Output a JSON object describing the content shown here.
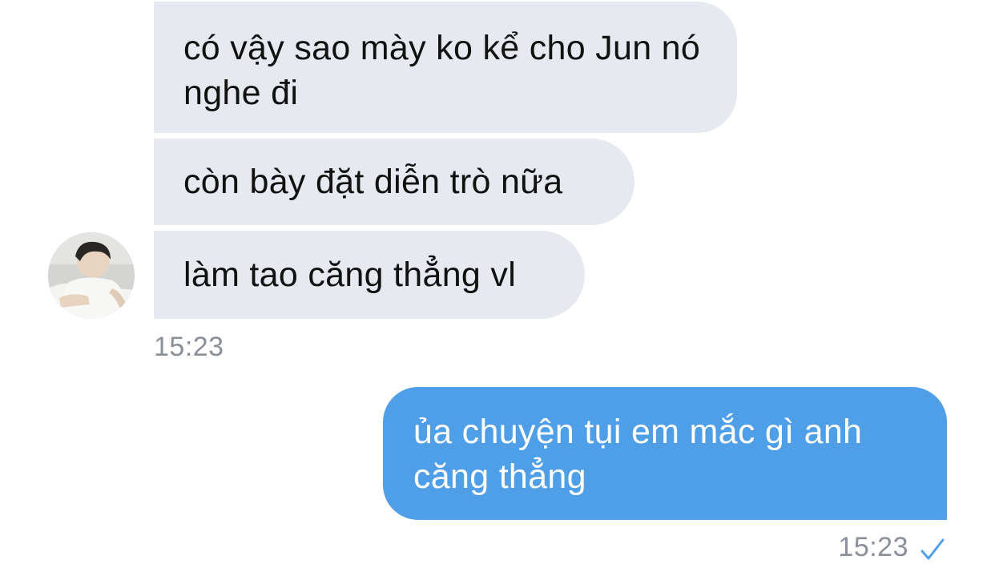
{
  "conversation": {
    "incoming": {
      "messages": [
        "có vậy sao mày ko kể cho Jun nó nghe đi",
        "còn bày đặt diễn trò nữa",
        "làm tao căng thẳng vl"
      ],
      "timestamp": "15:23",
      "avatar_icon": "person-photo-avatar"
    },
    "outgoing": {
      "messages": [
        "ủa chuyện tụi em mắc gì anh căng thẳng"
      ],
      "timestamp": "15:23",
      "status_icon": "checkmark-icon"
    }
  },
  "colors": {
    "incoming_bubble": "#e6e9f0",
    "outgoing_bubble": "#4f9ee8",
    "timestamp": "#8a8f99",
    "checkmark": "#4f9ee8"
  }
}
